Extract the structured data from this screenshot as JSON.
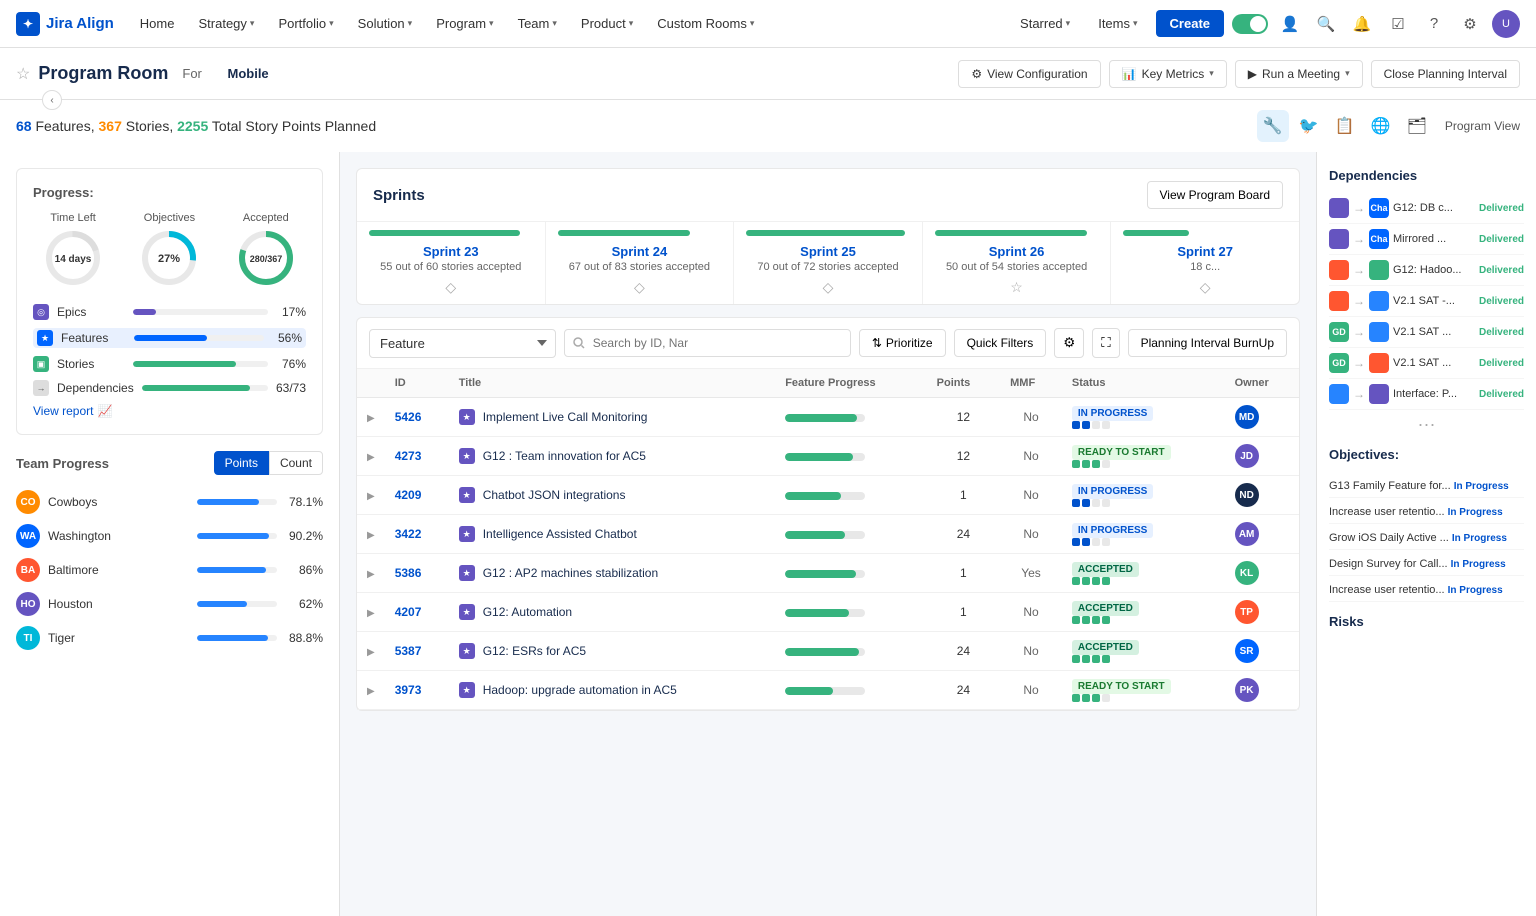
{
  "nav": {
    "logo_text": "Jira Align",
    "items": [
      "Home",
      "Strategy",
      "Portfolio",
      "Solution",
      "Program",
      "Team",
      "Product",
      "Custom Rooms",
      "Starred",
      "Items"
    ],
    "create_label": "Create"
  },
  "header": {
    "title": "Program Room",
    "for_label": "For",
    "context": "Mobile",
    "view_config_label": "View Configuration",
    "key_metrics_label": "Key Metrics",
    "run_meeting_label": "Run a Meeting",
    "close_interval_label": "Close Planning Interval",
    "program_view_label": "Program View"
  },
  "summary": {
    "features_count": "68",
    "stories_count": "367",
    "points_count": "2255",
    "features_label": "Features,",
    "stories_label": "Stories,",
    "points_label": "Total Story Points Planned"
  },
  "progress": {
    "label": "Progress:",
    "time_left_label": "Time Left",
    "time_left_value": "14 days",
    "objectives_label": "Objectives",
    "objectives_value": "27%",
    "accepted_label": "Accepted",
    "accepted_value": "280/367",
    "bars": [
      {
        "name": "Epics",
        "pct": 17,
        "color": "#6554c0",
        "pct_label": "17%"
      },
      {
        "name": "Features",
        "pct": 56,
        "color": "#0065ff",
        "pct_label": "56%"
      },
      {
        "name": "Stories",
        "pct": 76,
        "color": "#36b37e",
        "pct_label": "76%"
      },
      {
        "name": "Dependencies",
        "pct": 86,
        "color": "#ff5630",
        "pct_label": "63/73"
      }
    ],
    "view_report_label": "View report"
  },
  "team_progress": {
    "title": "Team Progress",
    "tabs": [
      "Points",
      "Count"
    ],
    "active_tab": "Points",
    "teams": [
      {
        "name": "Cowboys",
        "pct": 78.1,
        "pct_label": "78.1%",
        "color": "#2684ff"
      },
      {
        "name": "Washington",
        "pct": 90.2,
        "pct_label": "90.2%",
        "color": "#2684ff"
      },
      {
        "name": "Baltimore",
        "pct": 86,
        "pct_label": "86%",
        "color": "#2684ff"
      },
      {
        "name": "Houston",
        "pct": 62,
        "pct_label": "62%",
        "color": "#2684ff"
      },
      {
        "name": "Tiger",
        "pct": 88.8,
        "pct_label": "88.8%",
        "color": "#2684ff"
      }
    ]
  },
  "sprints": {
    "title": "Sprints",
    "view_board_label": "View Program Board",
    "items": [
      {
        "name": "Sprint 23",
        "accepted": "55 out of 60 stories accepted",
        "bar_pct": 92
      },
      {
        "name": "Sprint 24",
        "accepted": "67 out of 83 stories accepted",
        "bar_pct": 81
      },
      {
        "name": "Sprint 25",
        "accepted": "70 out of 72 stories accepted",
        "bar_pct": 97
      },
      {
        "name": "Sprint 26",
        "accepted": "50 out of 54 stories accepted",
        "bar_pct": 93
      },
      {
        "name": "Sprint 27",
        "accepted": "18 c...",
        "bar_pct": 40
      }
    ]
  },
  "feature_table": {
    "filter_placeholder": "Feature",
    "search_placeholder": "Search by ID, Nar",
    "prioritize_label": "Prioritize",
    "quick_filters_label": "Quick Filters",
    "burnup_label": "Planning Interval BurnUp",
    "columns": [
      "ID",
      "Title",
      "Feature Progress",
      "Points",
      "MMF",
      "Status",
      "Owner"
    ],
    "rows": [
      {
        "id": "5426",
        "title": "Implement Live Call Monitoring",
        "progress": 90,
        "points": "12",
        "mmf": "No",
        "status": "IN PROGRESS",
        "status_type": "in_progress",
        "owner_color": "#0052cc",
        "owner_initials": "MD"
      },
      {
        "id": "4273",
        "title": "G12 : Team innovation for AC5",
        "progress": 85,
        "points": "12",
        "mmf": "No",
        "status": "READY TO START",
        "status_type": "ready",
        "owner_color": "#6554c0",
        "owner_initials": "JD"
      },
      {
        "id": "4209",
        "title": "Chatbot JSON integrations",
        "progress": 70,
        "points": "1",
        "mmf": "No",
        "status": "IN PROGRESS",
        "status_type": "in_progress",
        "owner_color": "#172b4d",
        "owner_initials": "ND"
      },
      {
        "id": "3422",
        "title": "Intelligence Assisted Chatbot",
        "progress": 75,
        "points": "24",
        "mmf": "No",
        "status": "IN PROGRESS",
        "status_type": "in_progress",
        "owner_color": "#6554c0",
        "owner_initials": "AM"
      },
      {
        "id": "5386",
        "title": "G12 : AP2 machines stabilization",
        "progress": 88,
        "points": "1",
        "mmf": "Yes",
        "status": "ACCEPTED",
        "status_type": "accepted",
        "owner_color": "#36b37e",
        "owner_initials": "KL"
      },
      {
        "id": "4207",
        "title": "G12: Automation",
        "progress": 80,
        "points": "1",
        "mmf": "No",
        "status": "ACCEPTED",
        "status_type": "accepted",
        "owner_color": "#ff5630",
        "owner_initials": "TP"
      },
      {
        "id": "5387",
        "title": "G12: ESRs for AC5",
        "progress": 92,
        "points": "24",
        "mmf": "No",
        "status": "ACCEPTED",
        "status_type": "accepted",
        "owner_color": "#0065ff",
        "owner_initials": "SR"
      },
      {
        "id": "3973",
        "title": "Hadoop: upgrade automation in AC5",
        "progress": 60,
        "points": "24",
        "mmf": "No",
        "status": "READY TO START",
        "status_type": "ready",
        "owner_color": "#6554c0",
        "owner_initials": "PK"
      }
    ]
  },
  "dependencies": {
    "title": "Dependencies",
    "items": [
      {
        "from_color": "#6554c0",
        "from_abbr": "",
        "to_color": "#0065ff",
        "to_abbr": "Cha",
        "text": "G12: DB c...",
        "status": "Delivered"
      },
      {
        "from_color": "#6554c0",
        "from_abbr": "",
        "to_color": "#0065ff",
        "to_abbr": "Cha",
        "text": "Mirrored ...",
        "status": "Delivered"
      },
      {
        "from_color": "#ff5630",
        "from_abbr": "",
        "to_color": "#36b37e",
        "to_abbr": "",
        "text": "G12: Hadoo...",
        "status": "Delivered"
      },
      {
        "from_color": "#ff5630",
        "from_abbr": "",
        "to_color": "#2684ff",
        "to_abbr": "",
        "text": "V2.1 SAT -...",
        "status": "Delivered"
      },
      {
        "from_color": "#36b37e",
        "from_abbr": "GD",
        "to_color": "#2684ff",
        "to_abbr": "",
        "text": "V2.1 SAT ...",
        "status": "Delivered"
      },
      {
        "from_color": "#36b37e",
        "from_abbr": "GD",
        "to_color": "#ff5630",
        "to_abbr": "",
        "text": "V2.1 SAT ...",
        "status": "Delivered"
      },
      {
        "from_color": "#2684ff",
        "from_abbr": "",
        "to_color": "#6554c0",
        "to_abbr": "",
        "text": "Interface: P...",
        "status": "Delivered"
      }
    ]
  },
  "objectives": {
    "title": "Objectives:",
    "items": [
      {
        "text": "G13 Family Feature for...",
        "status": "In Progress"
      },
      {
        "text": "Increase user retentio...",
        "status": "In Progress"
      },
      {
        "text": "Grow iOS Daily Active ...",
        "status": "In Progress"
      },
      {
        "text": "Design Survey for Call...",
        "status": "In Progress"
      },
      {
        "text": "Increase user retentio...",
        "status": "In Progress"
      }
    ]
  }
}
